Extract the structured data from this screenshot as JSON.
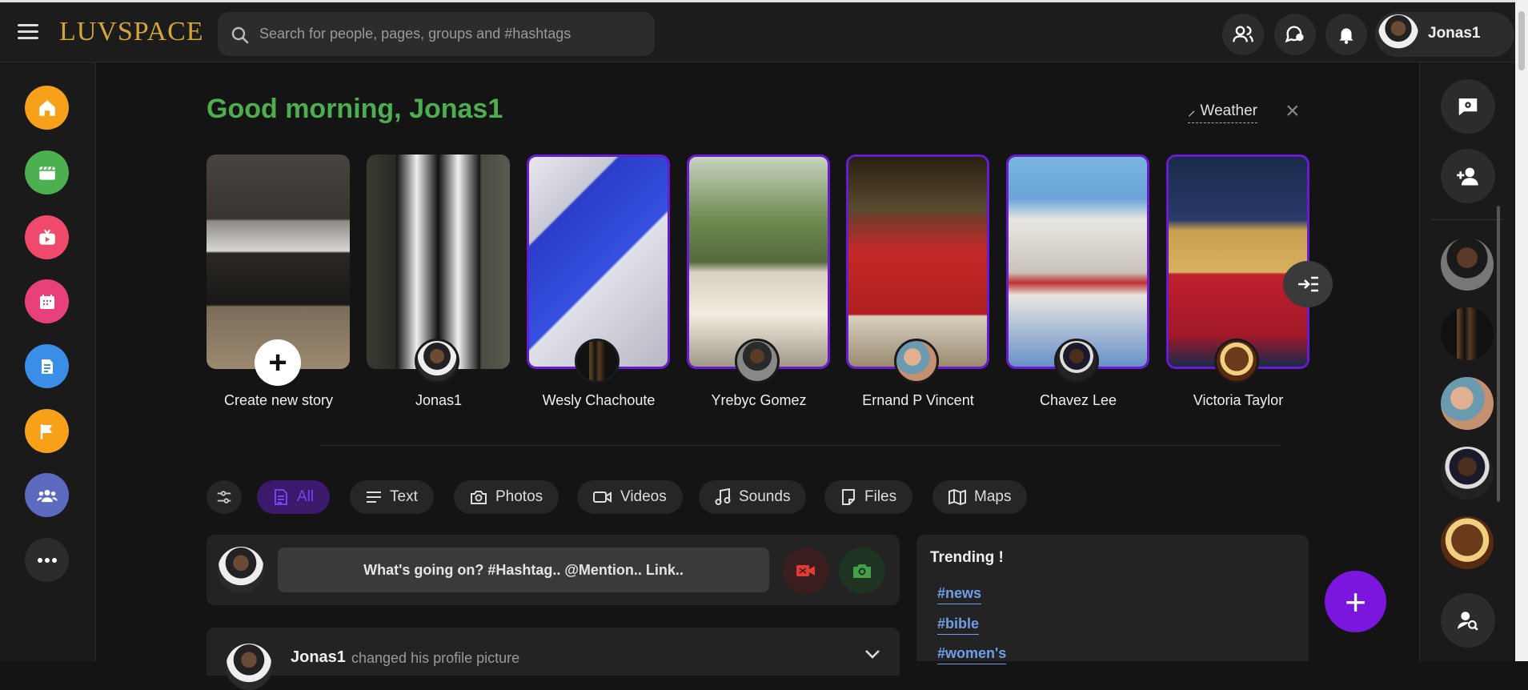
{
  "header": {
    "logo": "LUVSPACE",
    "search_placeholder": "Search for people, pages, groups and #hashtags",
    "username": "Jonas1",
    "icons": [
      "friends-icon",
      "chat-icon",
      "bell-icon"
    ]
  },
  "left_nav": {
    "items": [
      {
        "name": "home",
        "color": "#f7a11a"
      },
      {
        "name": "reels",
        "color": "#4caf50"
      },
      {
        "name": "watch",
        "color": "#ef4a6b"
      },
      {
        "name": "events",
        "color": "#e8407a"
      },
      {
        "name": "blogs",
        "color": "#3a8ee6"
      },
      {
        "name": "pages",
        "color": "#f7a11a"
      },
      {
        "name": "groups",
        "color": "#5c6bc0"
      },
      {
        "name": "more",
        "color": "#2c2c2c"
      }
    ]
  },
  "main": {
    "greeting": "Good morning, Jonas1",
    "weather_label": "Weather",
    "stories": [
      {
        "name": "Create new story",
        "ring": false
      },
      {
        "name": "Jonas1",
        "ring": false
      },
      {
        "name": "Wesly Chachoute",
        "ring": true
      },
      {
        "name": "Yrebyc Gomez",
        "ring": true
      },
      {
        "name": "Ernand P Vincent",
        "ring": true
      },
      {
        "name": "Chavez Lee",
        "ring": true
      },
      {
        "name": "Victoria Taylor",
        "ring": true
      }
    ],
    "filters": [
      {
        "label": "All",
        "active": true
      },
      {
        "label": "Text",
        "active": false
      },
      {
        "label": "Photos",
        "active": false
      },
      {
        "label": "Videos",
        "active": false
      },
      {
        "label": "Sounds",
        "active": false
      },
      {
        "label": "Files",
        "active": false
      },
      {
        "label": "Maps",
        "active": false
      }
    ],
    "composer_prompt": "What's going on? #Hashtag.. @Mention.. Link..",
    "post": {
      "author": "Jonas1",
      "action": "changed his profile picture"
    }
  },
  "trending": {
    "title": "Trending !",
    "tags": [
      "#news",
      "#bible",
      "#women's"
    ]
  },
  "colors": {
    "accent_purple": "#7a16dd",
    "greeting_green": "#4cae4f",
    "logo_gold": "#d4a53a",
    "tag_blue": "#6f9ee8"
  }
}
